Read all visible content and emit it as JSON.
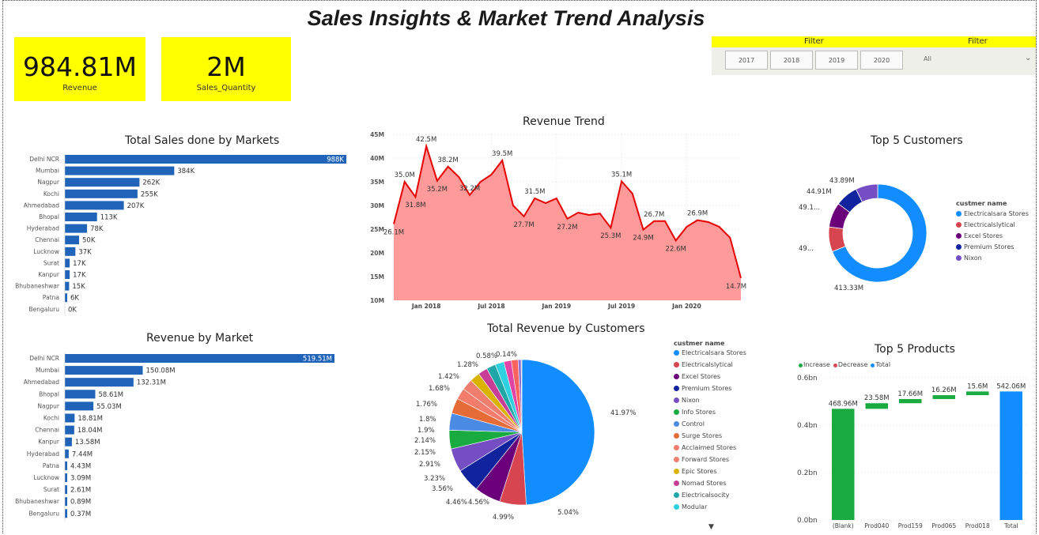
{
  "title": "Sales Insights & Market Trend Analysis",
  "kpis": [
    {
      "value": "984.81M",
      "label": "Revenue"
    },
    {
      "value": "2M",
      "label": "Sales_Quantity"
    }
  ],
  "filter": {
    "label_left": "Filter",
    "label_right": "Filter",
    "years": [
      "2017",
      "2018",
      "2019",
      "2020"
    ],
    "dropdown_value": "All"
  },
  "colors": {
    "accent_yellow": "#ffff00",
    "bar_blue": "#1f64b9",
    "trend_line": "#e60000",
    "trend_fill": "#ff9a9a"
  },
  "chart_data": [
    {
      "id": "sales_by_market",
      "type": "bar",
      "title": "Total Sales done by Markets",
      "categories": [
        "Delhi NCR",
        "Mumbai",
        "Nagpur",
        "Kochi",
        "Ahmedabad",
        "Bhopal",
        "Hyderabad",
        "Chennai",
        "Lucknow",
        "Surat",
        "Kanpur",
        "Bhubaneshwar",
        "Patna",
        "Bengaluru"
      ],
      "values": [
        988,
        384,
        262,
        255,
        207,
        113,
        78,
        50,
        37,
        17,
        17,
        15,
        6,
        0
      ],
      "labels": [
        "988K",
        "384K",
        "262K",
        "255K",
        "207K",
        "113K",
        "78K",
        "50K",
        "37K",
        "17K",
        "17K",
        "15K",
        "6K",
        "0K"
      ]
    },
    {
      "id": "revenue_by_market",
      "type": "bar",
      "title": "Revenue by Market",
      "categories": [
        "Delhi NCR",
        "Mumbai",
        "Ahmedabad",
        "Bhopal",
        "Nagpur",
        "Kochi",
        "Chennai",
        "Kanpur",
        "Hyderabad",
        "Patna",
        "Lucknow",
        "Surat",
        "Bhubaneshwar",
        "Bengaluru"
      ],
      "values": [
        519.51,
        150.08,
        132.31,
        58.61,
        55.03,
        18.81,
        18.04,
        13.58,
        7.44,
        4.43,
        3.09,
        2.61,
        0.89,
        0.37
      ],
      "labels": [
        "519.51M",
        "150.08M",
        "132.31M",
        "58.61M",
        "55.03M",
        "18.81M",
        "18.04M",
        "13.58M",
        "7.44M",
        "4.43M",
        "3.09M",
        "2.61M",
        "0.89M",
        "0.37M"
      ]
    },
    {
      "id": "revenue_trend",
      "type": "area",
      "title": "Revenue Trend",
      "y_ticks": [
        "45M",
        "40M",
        "35M",
        "30M",
        "25M",
        "20M",
        "15M",
        "10M"
      ],
      "ylim": [
        10,
        45
      ],
      "x_ticks": [
        "Jan 2018",
        "Jul 2018",
        "Jan 2019",
        "Jul 2019",
        "Jan 2020"
      ],
      "values": [
        26.1,
        35.0,
        31.8,
        42.5,
        35.2,
        38.2,
        36.0,
        32.2,
        35.0,
        36.5,
        39.5,
        30.0,
        27.7,
        31.5,
        30.5,
        31.5,
        27.2,
        28.5,
        28.0,
        28.3,
        25.3,
        35.1,
        32.5,
        24.9,
        26.7,
        26.7,
        22.6,
        25.5,
        26.9,
        26.5,
        25.5,
        23.2,
        14.7
      ],
      "point_labels": [
        "26.1M",
        "35.0M",
        "31.8M",
        "42.5M",
        "35.2M",
        "38.2M",
        "",
        "32.2M",
        "",
        "",
        "39.5M",
        "",
        "27.7M",
        "31.5M",
        "",
        "",
        "27.2M",
        "",
        "",
        "",
        "25.3M",
        "35.1M",
        "",
        "24.9M",
        "26.7M",
        "",
        "22.6M",
        "",
        "26.9M",
        "",
        "",
        "",
        "14.7M"
      ]
    },
    {
      "id": "top5_customers",
      "type": "pie",
      "title": "Top 5 Customers",
      "legend_title": "custmer name",
      "categories": [
        "Electricalsara Stores",
        "Electricalslytical",
        "Excel Stores",
        "Premium Stores",
        "Nixon"
      ],
      "values": [
        413.33,
        49.2,
        49.1,
        44.91,
        43.89
      ],
      "labels": [
        "413.33M",
        "49...",
        "49.1...",
        "44.91M",
        "43.89M"
      ],
      "colors": [
        "#118dff",
        "#d64550",
        "#6b007b",
        "#12239e",
        "#744ec2"
      ]
    },
    {
      "id": "revenue_by_customers",
      "type": "pie",
      "title": "Total Revenue by Customers",
      "legend_title": "custmer name",
      "legend": [
        "Electricalsara Stores",
        "Electricalslytical",
        "Excel Stores",
        "Premium Stores",
        "Nixon",
        "Info Stores",
        "Control",
        "Surge Stores",
        "Acclaimed Stores",
        "Forward Stores",
        "Epic Stores",
        "Nomad Stores",
        "Electricalsocity",
        "Modular"
      ],
      "values": [
        41.97,
        5.04,
        4.99,
        4.56,
        4.46,
        3.56,
        3.23,
        2.91,
        2.15,
        2.14,
        1.9,
        1.8,
        1.76,
        1.68,
        1.42,
        1.28,
        0.58,
        0.14
      ],
      "labels": [
        "41.97%",
        "5.04%",
        "4.99%",
        "4.56%",
        "4.46%",
        "3.56%",
        "3.23%",
        "2.91%",
        "2.15%",
        "2.14%",
        "1.9%",
        "1.8%",
        "1.76%",
        "1.68%",
        "1.42%",
        "1.28%",
        "0.58%",
        "0.14%"
      ]
    },
    {
      "id": "top5_products",
      "type": "bar",
      "title": "Top 5 Products",
      "legend": [
        "Increase",
        "Decrease",
        "Total"
      ],
      "categories": [
        "(Blank)",
        "Prod040",
        "Prod159",
        "Prod065",
        "Prod018",
        "Total"
      ],
      "values": [
        468.96,
        23.58,
        17.66,
        16.26,
        15.6,
        542.06
      ],
      "labels": [
        "468.96M",
        "23.58M",
        "17.66M",
        "16.26M",
        "15.6M",
        "542.06M"
      ],
      "y_ticks": [
        "0.6bn",
        "0.4bn",
        "0.2bn",
        "0.0bn"
      ],
      "ylim": [
        0,
        0.6
      ]
    }
  ]
}
